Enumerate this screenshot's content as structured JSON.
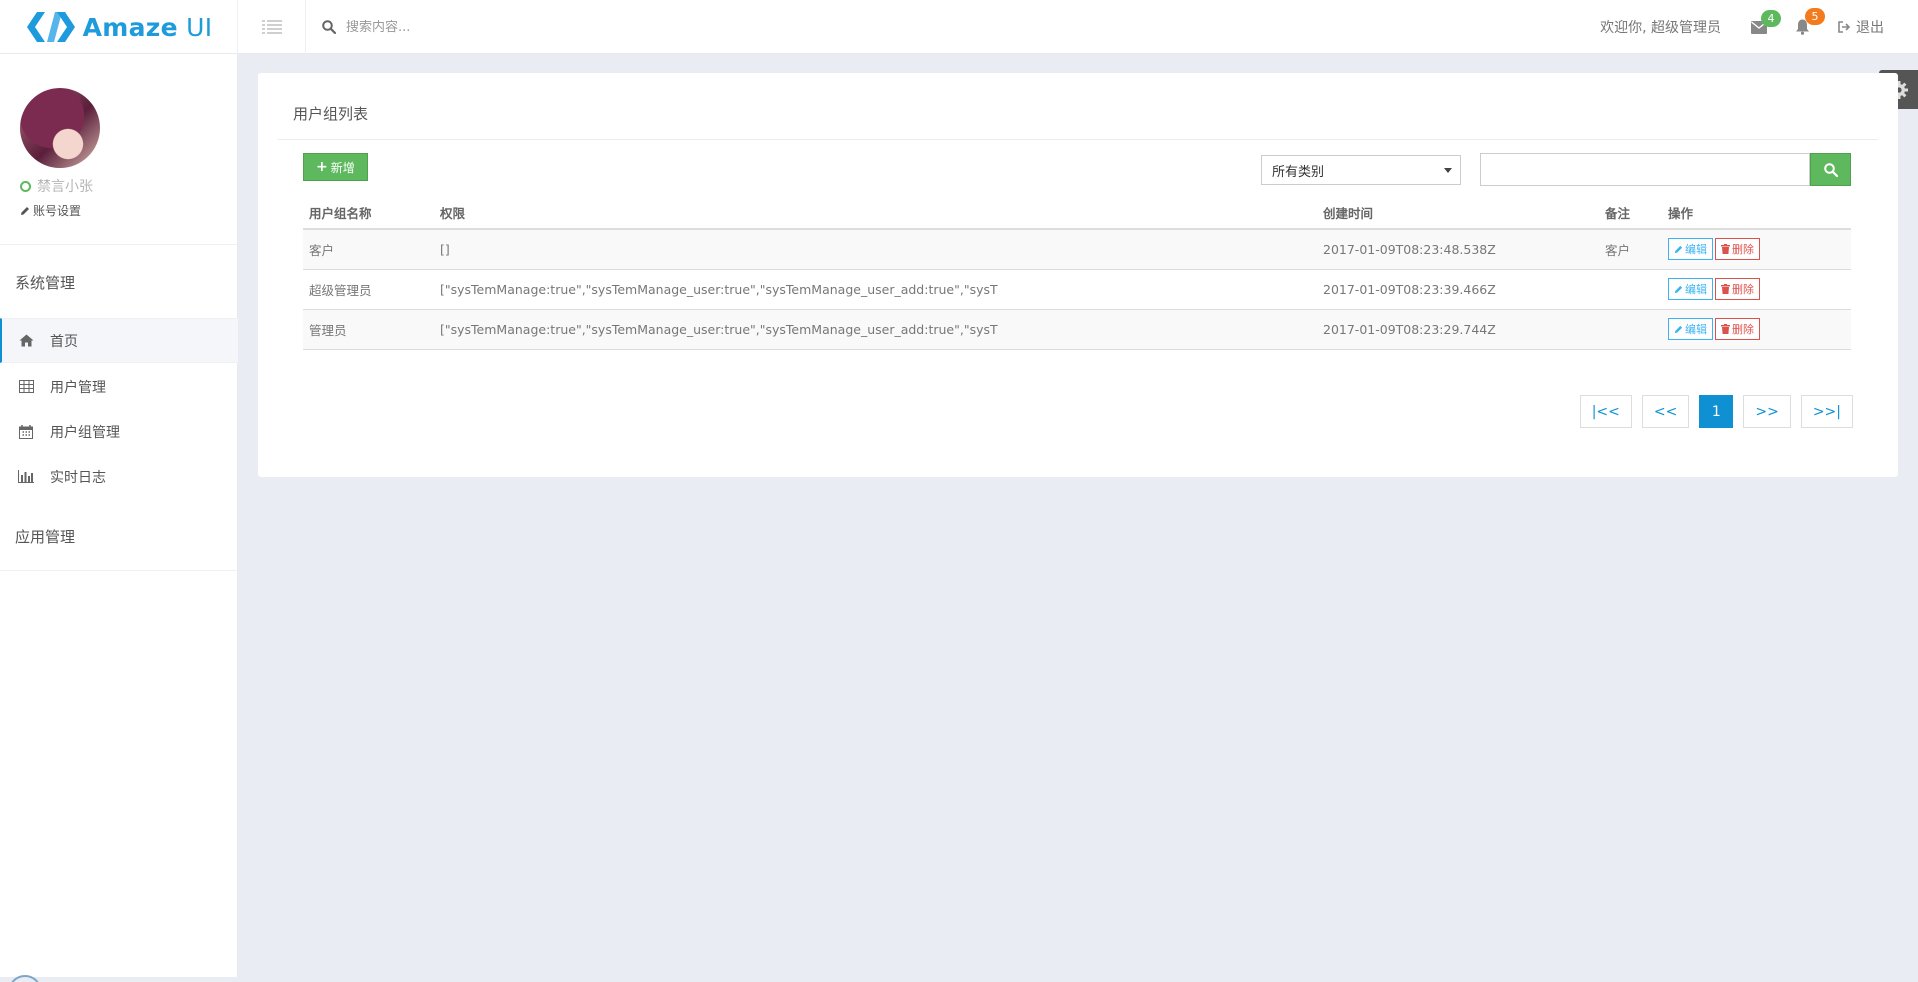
{
  "app": {
    "logo_text_bold": "Amaze",
    "logo_text_light": "UI"
  },
  "header": {
    "search_placeholder": "搜索内容...",
    "welcome": "欢迎你, 超级管理员",
    "mail_count": "4",
    "notify_count": "5",
    "logout_label": "退出"
  },
  "sidebar": {
    "user_name": "禁言小张",
    "account_settings": "账号设置",
    "group_system": "系统管理",
    "items": [
      {
        "label": "首页",
        "icon": "home-icon",
        "active": true
      },
      {
        "label": "用户管理",
        "icon": "table-icon",
        "active": false
      },
      {
        "label": "用户组管理",
        "icon": "calendar-icon",
        "active": false
      },
      {
        "label": "实时日志",
        "icon": "bar-chart-icon",
        "active": false
      }
    ],
    "group_app": "应用管理"
  },
  "panel": {
    "title": "用户组列表",
    "add_label": "新增",
    "category_selected": "所有类别",
    "search_value": "",
    "columns": [
      "用户组名称",
      "权限",
      "创建时间",
      "备注",
      "操作"
    ],
    "rows": [
      {
        "name": "客户",
        "perm": "[]",
        "time": "2017-01-09T08:23:48.538Z",
        "note": "客户"
      },
      {
        "name": "超级管理员",
        "perm": "[\"sysTemManage:true\",\"sysTemManage_user:true\",\"sysTemManage_user_add:true\",\"sysT",
        "time": "2017-01-09T08:23:39.466Z",
        "note": ""
      },
      {
        "name": "管理员",
        "perm": "[\"sysTemManage:true\",\"sysTemManage_user:true\",\"sysTemManage_user_add:true\",\"sysT",
        "time": "2017-01-09T08:23:29.744Z",
        "note": ""
      }
    ],
    "edit_label": "编辑",
    "delete_label": "删除",
    "pager": {
      "first": "|<<",
      "prev": "<<",
      "current": "1",
      "next": ">>",
      "last": ">>|"
    }
  },
  "colors": {
    "brand": "#1e9bdc",
    "primary": "#0e90d2",
    "success": "#5eb95e",
    "danger": "#dd514c",
    "warning": "#f37b1d",
    "background": "#e9ecf3"
  }
}
